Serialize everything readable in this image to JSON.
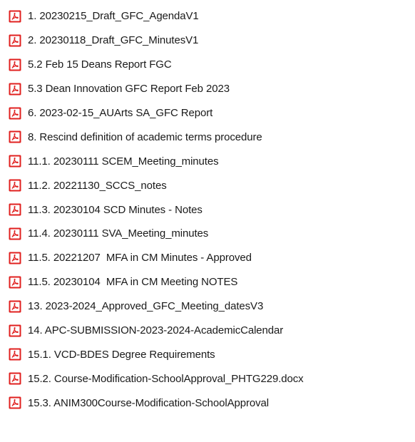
{
  "explorer": {
    "files": [
      {
        "name": "1. 20230215_Draft_GFC_AgendaV1",
        "icon": "pdf-file-icon"
      },
      {
        "name": "2. 20230118_Draft_GFC_MinutesV1",
        "icon": "pdf-file-icon"
      },
      {
        "name": "5.2 Feb 15 Deans Report FGC",
        "icon": "pdf-file-icon"
      },
      {
        "name": "5.3 Dean Innovation GFC Report Feb 2023",
        "icon": "pdf-file-icon"
      },
      {
        "name": "6. 2023-02-15_AUArts SA_GFC Report",
        "icon": "pdf-file-icon"
      },
      {
        "name": "8. Rescind definition of academic terms procedure",
        "icon": "pdf-file-icon"
      },
      {
        "name": "11.1. 20230111 SCEM_Meeting_minutes",
        "icon": "pdf-file-icon"
      },
      {
        "name": "11.2. 20221130_SCCS_notes",
        "icon": "pdf-file-icon"
      },
      {
        "name": "11.3. 20230104 SCD Minutes - Notes",
        "icon": "pdf-file-icon"
      },
      {
        "name": "11.4. 20230111 SVA_Meeting_minutes",
        "icon": "pdf-file-icon"
      },
      {
        "name": "11.5. 20221207  MFA in CM Minutes - Approved",
        "icon": "pdf-file-icon"
      },
      {
        "name": "11.5. 20230104  MFA in CM Meeting NOTES",
        "icon": "pdf-file-icon"
      },
      {
        "name": "13. 2023-2024_Approved_GFC_Meeting_datesV3",
        "icon": "pdf-file-icon"
      },
      {
        "name": "14. APC-SUBMISSION-2023-2024-AcademicCalendar",
        "icon": "pdf-file-icon"
      },
      {
        "name": "15.1. VCD-BDES Degree Requirements",
        "icon": "pdf-file-icon"
      },
      {
        "name": "15.2. Course-Modification-SchoolApproval_PHTG229.docx",
        "icon": "pdf-file-icon"
      },
      {
        "name": "15.3. ANIM300Course-Modification-SchoolApproval",
        "icon": "pdf-file-icon"
      }
    ]
  },
  "colors": {
    "icon_red": "#e0201f",
    "icon_bg": "#ffffff",
    "text": "#1a1a1a"
  }
}
